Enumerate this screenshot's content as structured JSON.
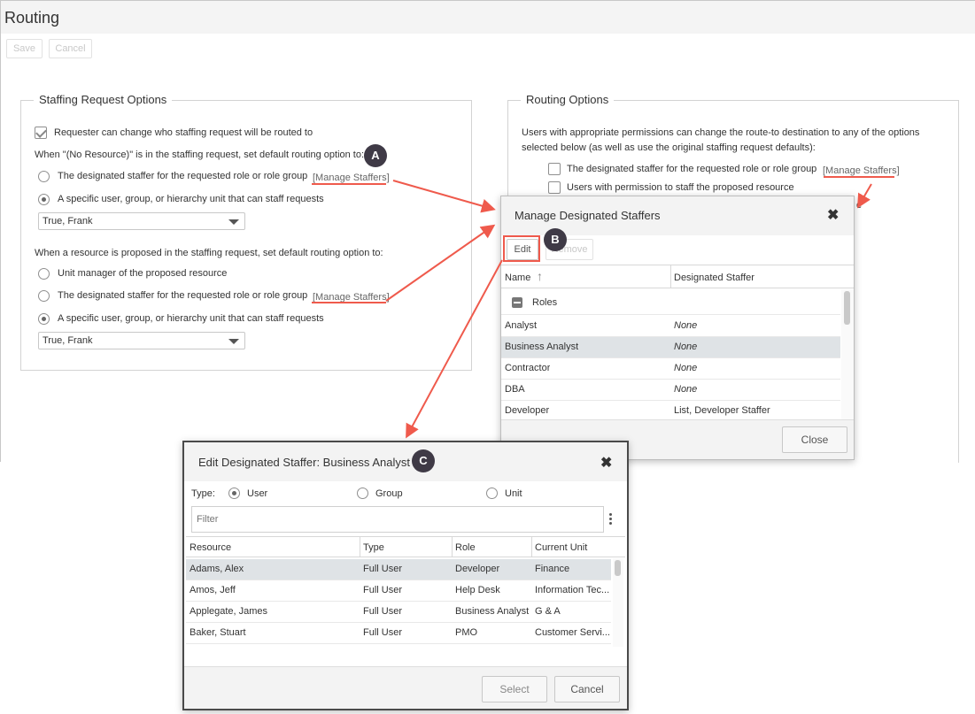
{
  "page": {
    "title": "Routing",
    "save_label": "Save",
    "cancel_label": "Cancel"
  },
  "staffing_request_options": {
    "legend": "Staffing Request Options",
    "requester_checkbox_label": "Requester can change who staffing request will be routed to",
    "no_resource_heading": "When \"(No Resource)\" is in the staffing request, set default routing option to:",
    "no_resource_options": [
      {
        "label": "The designated staffer for the requested role or role group",
        "link": "[Manage Staffers]",
        "selected": false
      },
      {
        "label": "A specific user, group, or hierarchy unit that can staff requests",
        "selected": true
      }
    ],
    "no_resource_select_value": "True, Frank",
    "proposed_heading": "When a resource is proposed in the staffing request, set default routing option to:",
    "proposed_options": [
      {
        "label": "Unit manager of the proposed resource",
        "selected": false
      },
      {
        "label": "The designated staffer for the requested role or role group",
        "link": "[Manage Staffers]",
        "selected": false
      },
      {
        "label": "A specific user, group, or hierarchy unit that can staff requests",
        "selected": true
      }
    ],
    "proposed_select_value": "True, Frank"
  },
  "routing_options": {
    "legend": "Routing Options",
    "description_line1": "Users with appropriate permissions can change the route-to destination to any of the options",
    "description_line2": "selected below (as well as use the original staffing request defaults):",
    "options": [
      {
        "label": "The designated staffer for the requested role or role group",
        "link": "[Manage Staffers]"
      },
      {
        "label": "Users with permission to staff the proposed resource"
      }
    ],
    "partial_char": "e"
  },
  "manage_dialog": {
    "title": "Manage Designated Staffers",
    "edit_label": "Edit",
    "remove_label": "Remove",
    "col_name": "Name",
    "col_staffer": "Designated Staffer",
    "group_label": "Roles",
    "rows": [
      {
        "name": "Analyst",
        "staffer": "None"
      },
      {
        "name": "Business Analyst",
        "staffer": "None"
      },
      {
        "name": "Contractor",
        "staffer": "None"
      },
      {
        "name": "DBA",
        "staffer": "None"
      },
      {
        "name": "Developer",
        "staffer": "List, Developer Staffer"
      }
    ],
    "close_label": "Close"
  },
  "edit_dialog": {
    "title": "Edit Designated Staffer: Business Analyst",
    "type_label": "Type:",
    "type_options": [
      {
        "label": "User",
        "selected": true
      },
      {
        "label": "Group",
        "selected": false
      },
      {
        "label": "Unit",
        "selected": false
      }
    ],
    "filter_placeholder": "Filter",
    "columns": [
      "Resource",
      "Type",
      "Role",
      "Current Unit"
    ],
    "rows": [
      {
        "resource": "Adams, Alex",
        "type": "Full User",
        "role": "Developer",
        "unit": "Finance"
      },
      {
        "resource": "Amos, Jeff",
        "type": "Full User",
        "role": "Help Desk",
        "unit": "Information Tec..."
      },
      {
        "resource": "Applegate, James",
        "type": "Full User",
        "role": "Business Analyst",
        "unit": "G & A"
      },
      {
        "resource": "Baker, Stuart",
        "type": "Full User",
        "role": "PMO",
        "unit": "Customer Servi..."
      }
    ],
    "select_label": "Select",
    "cancel_label": "Cancel"
  },
  "markers": {
    "a": "A",
    "b": "B",
    "c": "C"
  },
  "colors": {
    "annotation_red": "#ef5a4c",
    "marker_bg": "#3f3a46",
    "selected_row": "#dfe3e6"
  }
}
